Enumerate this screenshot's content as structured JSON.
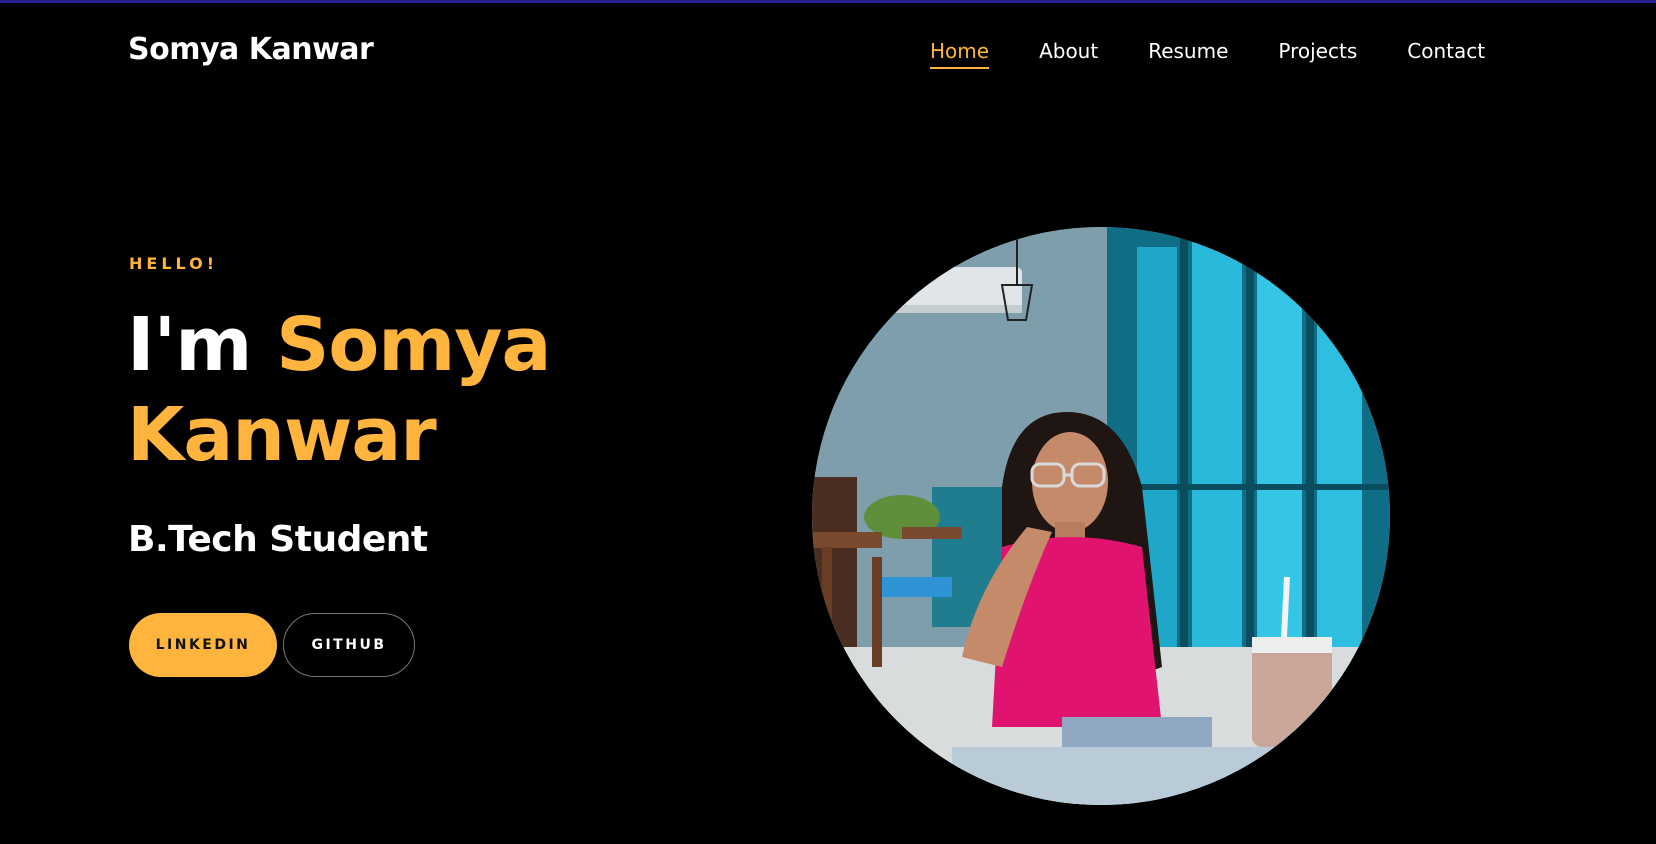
{
  "header": {
    "brand": "Somya Kanwar",
    "nav": [
      {
        "label": "Home",
        "active": true
      },
      {
        "label": "About"
      },
      {
        "label": "Resume"
      },
      {
        "label": "Projects"
      },
      {
        "label": "Contact"
      }
    ]
  },
  "hero": {
    "greeting": "HELLO!",
    "headline_prefix": "I'm ",
    "name_first": "Somya",
    "name_last": "Kanwar",
    "subtitle": "B.Tech Student",
    "buttons": {
      "linkedin": "LINKEDIN",
      "github": "GITHUB"
    }
  },
  "colors": {
    "accent": "#ffb53d",
    "background": "#000000",
    "top_border": "#2a1f8f"
  }
}
